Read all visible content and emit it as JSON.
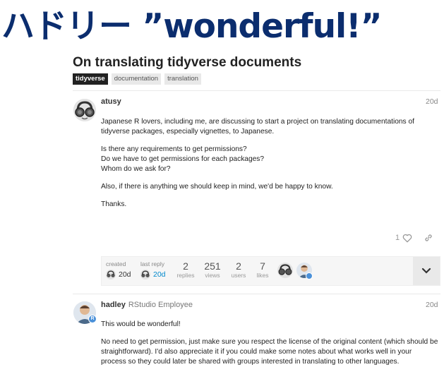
{
  "slide": {
    "title": "ハドリー ”wonderful!”"
  },
  "topic": {
    "title": "On translating tidyverse documents",
    "tags": [
      "tidyverse",
      "documentation",
      "translation"
    ]
  },
  "post1": {
    "username": "atusy",
    "date": "20d",
    "paragraphs": [
      "Japanese R lovers, including me, are discussing to start a project on translating documentations of tidyverse packages, especially vignettes, to Japanese.",
      "Is there any requirements to get permissions?",
      "Do we have to get permissions for each packages?",
      "Whom do we ask for?",
      "Also, if there is anything we should keep in mind, we'd be happy to know.",
      "Thanks."
    ],
    "like_count": "1"
  },
  "topic_map": {
    "created_label": "created",
    "created_value": "20d",
    "last_reply_label": "last reply",
    "last_reply_value": "20d",
    "replies_num": "2",
    "replies_label": "replies",
    "views_num": "251",
    "views_label": "views",
    "users_num": "2",
    "users_label": "users",
    "likes_num": "7",
    "likes_label": "likes"
  },
  "post2": {
    "username": "hadley",
    "user_title": "RStudio Employee",
    "date": "20d",
    "badge": "R",
    "paragraphs": [
      "This would be wonderful!",
      "No need to get permission, just make sure you respect the license of the original content (which should be straightforward). I'd also appreciate it if you could make some notes about what works well in your process so they could later be shared with groups interested in translating to other languages."
    ]
  },
  "colors": {
    "title_navy": "#0b2d6e",
    "link_blue": "#0088cc",
    "badge_blue": "#4a90d9"
  },
  "icons": [
    "heart-icon",
    "link-icon",
    "chevron-down-icon"
  ]
}
